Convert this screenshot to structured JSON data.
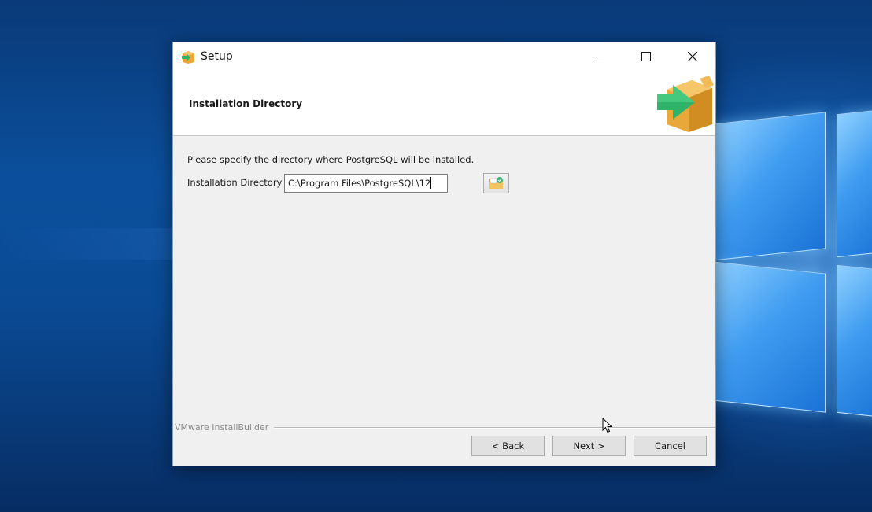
{
  "window": {
    "title": "Setup",
    "controls": {
      "minimize": "minimize-icon",
      "maximize": "maximize-icon",
      "close": "close-icon"
    }
  },
  "header": {
    "title": "Installation Directory",
    "logo_icon": "installer-box-arrow-icon"
  },
  "content": {
    "prompt": "Please specify the directory where PostgreSQL will be installed.",
    "directory_label": "Installation Directory",
    "directory_value": "C:\\Program Files\\PostgreSQL\\12",
    "browse_icon": "folder-browse-icon"
  },
  "footer": {
    "brand": "VMware InstallBuilder",
    "back_label": "< Back",
    "next_label": "Next >",
    "cancel_label": "Cancel"
  },
  "colors": {
    "desktop_background": "#0b4f9c",
    "dialog_background": "#f0f0f0",
    "button_face": "#e1e1e1",
    "logo_box": "#e8a93a",
    "logo_arrow": "#2fb36a"
  }
}
